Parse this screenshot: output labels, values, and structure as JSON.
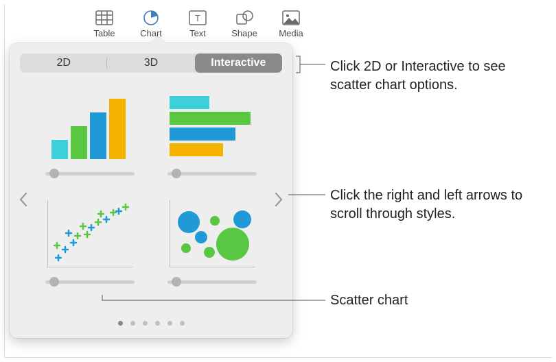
{
  "toolbar": {
    "items": [
      {
        "label": "Table"
      },
      {
        "label": "Chart"
      },
      {
        "label": "Text"
      },
      {
        "label": "Shape"
      },
      {
        "label": "Media"
      }
    ]
  },
  "popover": {
    "tabs": {
      "tab_2d": "2D",
      "tab_3d": "3D",
      "tab_interactive": "Interactive",
      "active": "Interactive"
    },
    "charts": {
      "top_left": "interactive-column-chart",
      "top_right": "interactive-bar-chart",
      "bottom_left": "interactive-scatter-chart",
      "bottom_right": "interactive-bubble-chart"
    },
    "page_count": 6,
    "active_page": 0
  },
  "annotations": {
    "tabs_hint": "Click 2D or Interactive to see scatter chart options.",
    "arrows_hint": "Click the right and left arrows to scroll through styles.",
    "scatter_label": "Scatter chart"
  },
  "colors": {
    "green": "#5ac742",
    "blue": "#1f9ad6",
    "cyan": "#3ed0d8",
    "yellow": "#f5b301"
  }
}
